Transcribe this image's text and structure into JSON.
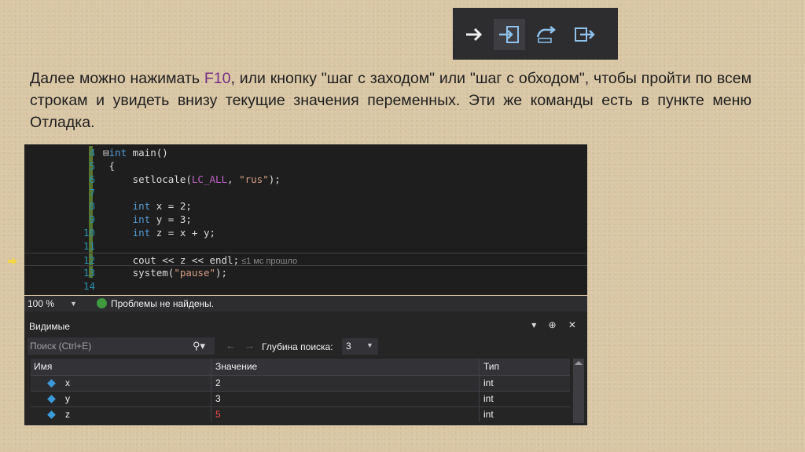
{
  "toolbar": {
    "buttons": [
      {
        "icon": "run-arrow-icon"
      },
      {
        "icon": "step-into-icon"
      },
      {
        "icon": "step-over-icon"
      },
      {
        "icon": "step-out-icon"
      }
    ]
  },
  "description": {
    "part1": "Далее можно нажимать ",
    "key": "F10",
    "part2": ", или кнопку \"шаг с заходом\" или \"шаг с обходом\", чтобы пройти по всем строкам и увидеть внизу текущие значения переменных. Эти же команды есть в пункте меню Отладка."
  },
  "editor": {
    "lines": [
      {
        "num": "4",
        "pre": "⊟",
        "kw": "int",
        "rest": " main()"
      },
      {
        "num": "5",
        "rest": " {"
      },
      {
        "num": "6",
        "rest": "     setlocale(",
        "mac": "LC_ALL",
        "rest2": ", ",
        "str": "\"rus\"",
        "rest3": ");"
      },
      {
        "num": "7",
        "rest": ""
      },
      {
        "num": "8",
        "kw": "int",
        "rest": " x = 2;"
      },
      {
        "num": "9",
        "kw": "int",
        "rest": " y = 3;"
      },
      {
        "num": "10",
        "kw": "int",
        "rest": " z = x + y;"
      },
      {
        "num": "11",
        "rest": ""
      },
      {
        "num": "12",
        "rest": "     cout << z << endl;",
        "hint": " ≤1 мс прошло"
      },
      {
        "num": "13",
        "rest": "     system(",
        "str": "\"pause\"",
        "rest3": ");"
      },
      {
        "num": "14",
        "rest": ""
      },
      {
        "num": "",
        "rest": " }"
      }
    ]
  },
  "status": {
    "zoom": "100 %",
    "message": "Проблемы не найдены."
  },
  "panel": {
    "title": "Видимые",
    "controls": "▾ ⊕ ✕",
    "search_placeholder": "Поиск (Ctrl+E)",
    "depth_label": "Глубина поиска:",
    "depth_value": "3",
    "columns": [
      "Имя",
      "Значение",
      "Тип"
    ],
    "rows": [
      {
        "name": "x",
        "value": "2",
        "type": "int",
        "changed": false
      },
      {
        "name": "y",
        "value": "3",
        "type": "int",
        "changed": false
      },
      {
        "name": "z",
        "value": "5",
        "type": "int",
        "changed": true
      }
    ]
  }
}
